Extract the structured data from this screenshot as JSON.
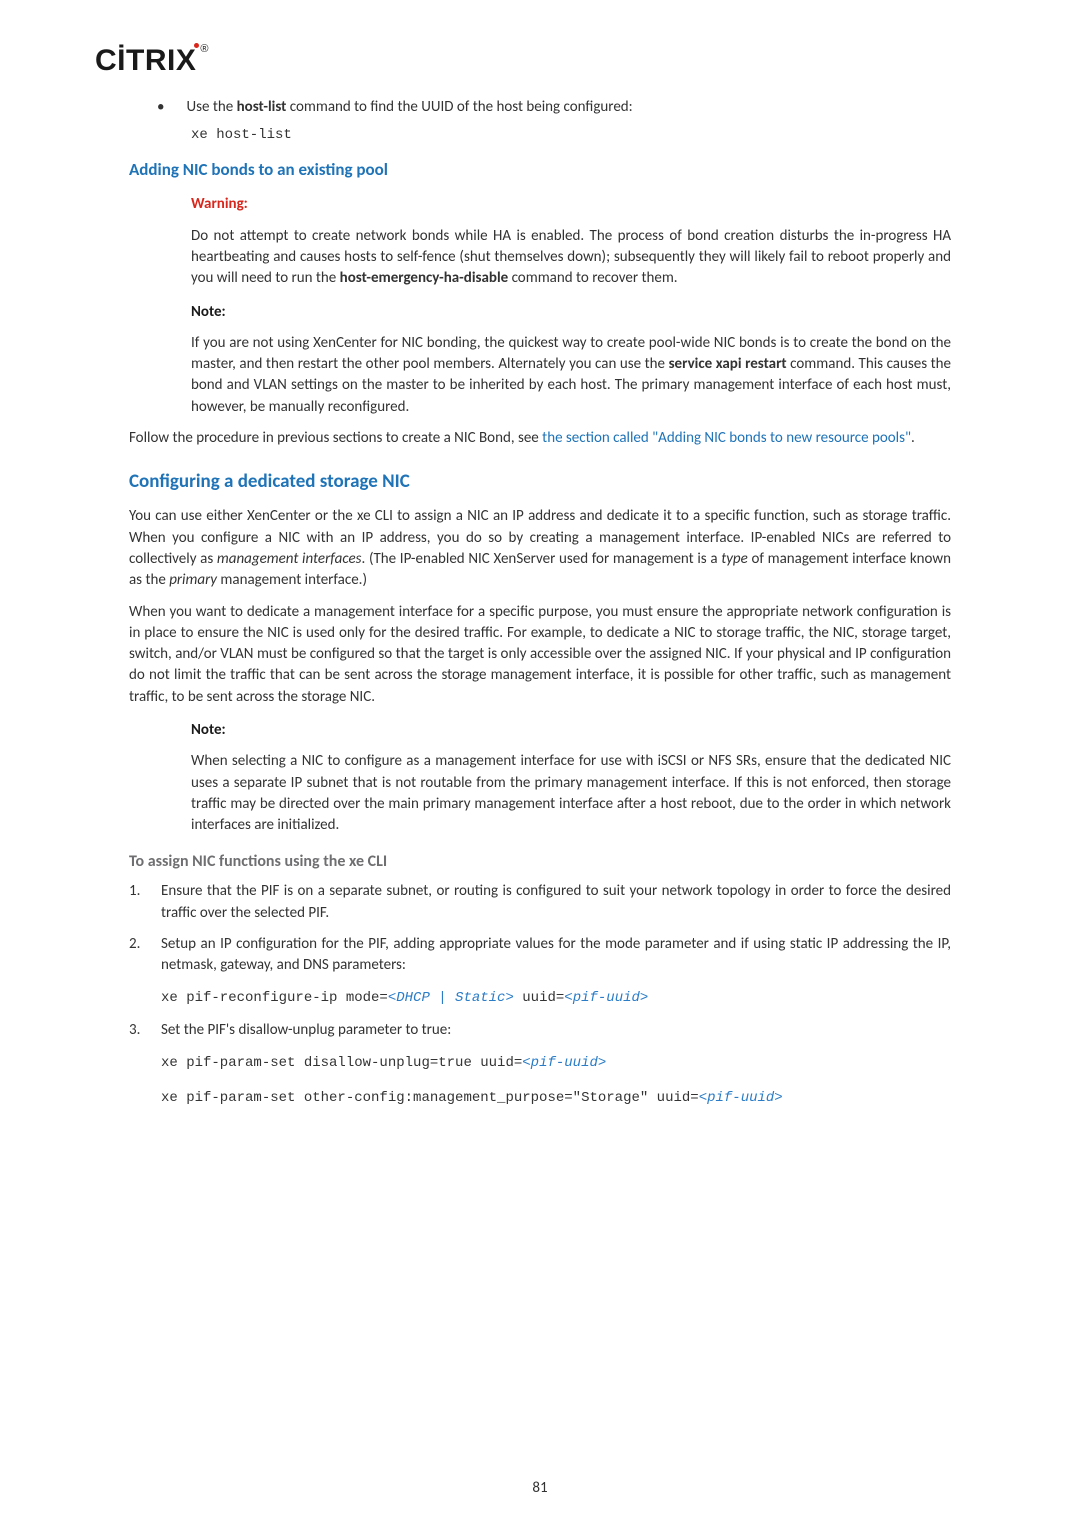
{
  "logo_text": "CİTRIX",
  "bullet": {
    "text_a": "Use the ",
    "bold": "host-list",
    "text_b": " command to find the UUID of the host being configured:"
  },
  "code_hostlist": "xe host-list",
  "h3_adding": "Adding NIC bonds to an existing pool",
  "warning": {
    "label": "Warning:",
    "p1_a": "Do not attempt to create network bonds while HA is enabled. The process of bond creation disturbs the in-progress HA heartbeating and causes hosts to self-fence (shut themselves down); subsequently they will likely fail to reboot properly and you will need to run the ",
    "p1_bold": "host-emergency-ha-disable",
    "p1_b": " command to recover them."
  },
  "note1": {
    "label": "Note:",
    "p1_a": "If you are not using XenCenter for NIC bonding, the quickest way to create pool-wide NIC bonds is to create the bond on the master, and then restart the other pool members. Alternately you can use the ",
    "p1_bold": "service xapi restart",
    "p1_b": " command. This causes the bond and VLAN settings on the master to be inherited by each host. The primary management interface of each host must, however, be manually reconfigured."
  },
  "follow": {
    "a": "Follow the procedure in previous sections to create a NIC Bond, see ",
    "link": "the section called \"Adding NIC bonds to new resource pools\"",
    "b": "."
  },
  "h2_conf": "Configuring a dedicated storage NIC",
  "conf_p1_a": "You can use either XenCenter or the xe CLI to assign a NIC an IP address and dedicate it to a specific function, such as storage traffic. When you configure a NIC with an IP address, you do so by creating a management interface. IP-enabled NICs are referred to collectively as ",
  "conf_p1_i1": "management interfaces",
  "conf_p1_b": ". (The IP-enabled NIC XenServer used for management is a ",
  "conf_p1_i2": "type",
  "conf_p1_c": " of management interface known as the ",
  "conf_p1_i3": "primary",
  "conf_p1_d": " management interface.)",
  "conf_p2": "When you want to dedicate a management interface for a specific purpose, you must ensure the appropriate network configuration is in place to ensure the NIC is used only for the desired traffic. For example, to dedicate a NIC to storage traffic, the NIC, storage target, switch, and/or VLAN must be configured so that the target is only accessible over the assigned NIC. If your physical and IP configuration do not limit the traffic that can be sent across the storage management interface, it is possible for other traffic, such as management traffic, to be sent across the storage NIC.",
  "note2": {
    "label": "Note:",
    "p1": "When selecting a NIC to configure as a management interface for use with iSCSI or NFS SRs, ensure that the dedicated NIC uses a separate IP subnet that is not routable from the primary management interface. If this is not enforced, then storage traffic may be directed over the main primary management interface after a host reboot, due to the order in which network interfaces are initialized."
  },
  "h4_assign": "To assign NIC functions using the xe CLI",
  "ol": {
    "n1": "1.",
    "i1": "Ensure that the PIF is on a separate subnet, or routing is configured to suit your network topology in order to force the desired traffic over the selected PIF.",
    "n2": "2.",
    "i2": "Setup an IP configuration for the PIF, adding appropriate values for the mode parameter and if using static IP addressing the IP, netmask, gateway, and DNS parameters:",
    "code2_a": "xe pif-reconfigure-ip mode=",
    "code2_v1": "<DHCP | Static>",
    "code2_b": " uuid=",
    "code2_v2": "<pif-uuid>",
    "n3": "3.",
    "i3": "Set the PIF's disallow-unplug parameter to true:",
    "code3a_a": "xe pif-param-set disallow-unplug=true uuid=",
    "code3a_v": "<pif-uuid>",
    "code3b_a": "xe pif-param-set other-config:management_purpose=\"Storage\" uuid=",
    "code3b_v": "<pif-uuid>"
  },
  "pagenum": "81"
}
